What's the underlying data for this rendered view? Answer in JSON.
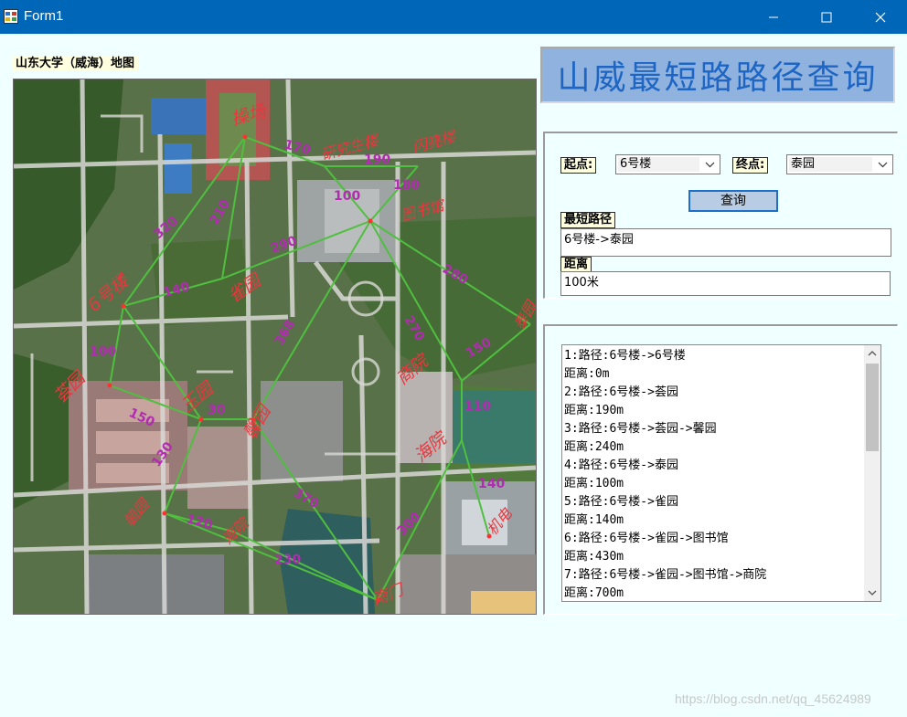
{
  "window": {
    "title": "Form1",
    "accent": "#0067b8"
  },
  "map": {
    "label": "山东大学（威海）地图",
    "places": [
      "操场",
      "研究生楼",
      "闪亮楼",
      "图书馆",
      "6号楼",
      "雀园",
      "荟园",
      "商院",
      "玉园",
      "馨园",
      "毓园",
      "海院",
      "机电",
      "泰园",
      "南门"
    ],
    "distances": [
      "170",
      "190",
      "100",
      "180",
      "320",
      "210",
      "290",
      "140",
      "100",
      "368",
      "270",
      "280",
      "150",
      "150",
      "30",
      "110",
      "130",
      "140",
      "370",
      "300",
      "120",
      "230"
    ]
  },
  "heading": "山威最短路路径查询",
  "query": {
    "start_label": "起点:",
    "start_value": "6号楼",
    "end_label": "终点:",
    "end_value": "泰园",
    "query_button": "查询",
    "path_label": "最短路径",
    "path_value": "6号楼->泰园",
    "distance_label": "距离",
    "distance_value": "100米"
  },
  "results": [
    "1:路径:6号楼->6号楼",
    "距离:0m",
    "2:路径:6号楼->荟园",
    "距离:190m",
    "3:路径:6号楼->荟园->馨园",
    "距离:240m",
    "4:路径:6号楼->泰园",
    "距离:100m",
    "5:路径:6号楼->雀园",
    "距离:140m",
    "6:路径:6号楼->雀园->图书馆",
    "距离:430m",
    "7:路径:6号楼->雀园->图书馆->商院",
    "距离:700m"
  ],
  "watermark": "https://blog.csdn.net/qq_45624989"
}
